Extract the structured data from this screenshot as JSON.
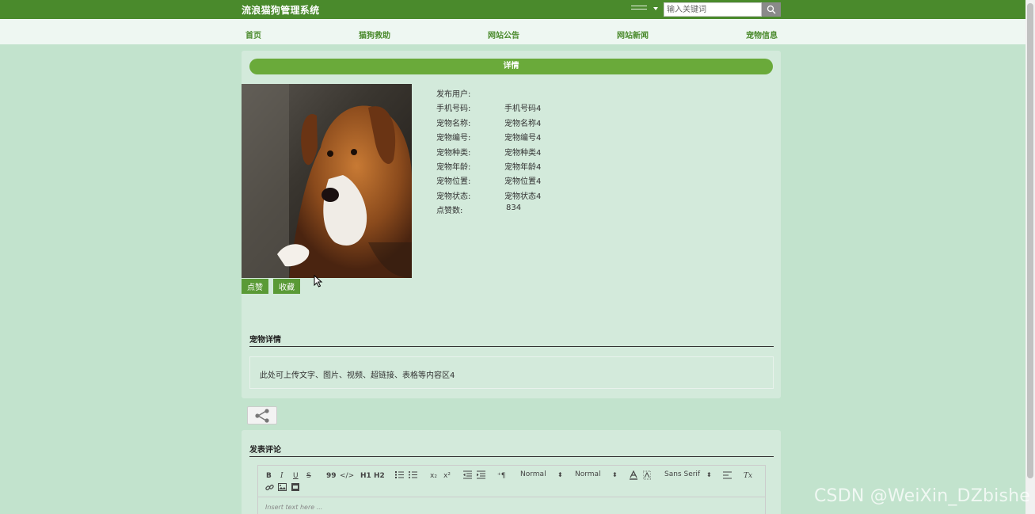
{
  "header": {
    "site_title": "流浪猫狗管理系统",
    "search_placeholder": "输入关键词"
  },
  "nav": {
    "items": [
      "首页",
      "猫狗救助",
      "网站公告",
      "网站新闻",
      "宠物信息"
    ]
  },
  "detail": {
    "header": "详情",
    "fields": [
      {
        "label": "发布用户:",
        "value": ""
      },
      {
        "label": "手机号码:",
        "value": "手机号码4"
      },
      {
        "label": "宠物名称:",
        "value": "宠物名称4"
      },
      {
        "label": "宠物编号:",
        "value": "宠物编号4"
      },
      {
        "label": "宠物种类:",
        "value": "宠物种类4"
      },
      {
        "label": "宠物年龄:",
        "value": "宠物年龄4"
      },
      {
        "label": "宠物位置:",
        "value": "宠物位置4"
      },
      {
        "label": "宠物状态:",
        "value": "宠物状态4"
      },
      {
        "label": "点赞数:",
        "value": "834"
      }
    ],
    "like_button": "点赞",
    "favorite_button": "收藏",
    "section_title": "宠物详情",
    "content": "此处可上传文字、图片、视频、超链接、表格等内容区4"
  },
  "comment": {
    "section_title": "发表评论",
    "toolbar": {
      "bold": "B",
      "italic": "I",
      "underline": "U",
      "strike": "S",
      "quote": "99",
      "code": "</>",
      "h1": "H1",
      "h2": "H2",
      "sub": "x₂",
      "sup": "x²",
      "rtl": "⁺¶",
      "size_select": "Normal",
      "header_select": "Normal",
      "font_select": "Sans Serif",
      "clear": "Tx"
    },
    "placeholder": "Insert text here ..."
  },
  "watermark": "CSDN @WeiXin_DZbishe",
  "colors": {
    "page_bg": "#c2e3cd",
    "topbar": "#4a8a2c",
    "accent": "#6aaa3a",
    "button": "#5a9a36",
    "nav_text": "#4a8a2c"
  }
}
